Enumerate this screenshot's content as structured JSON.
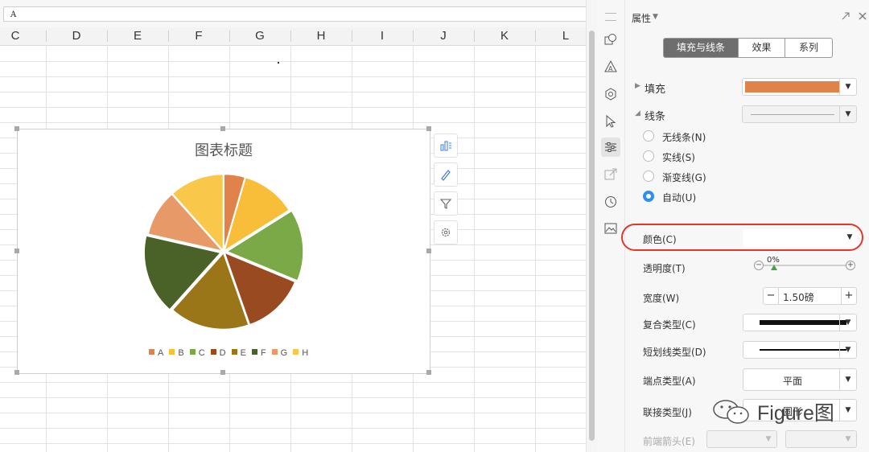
{
  "formula_bar": {
    "value": "A"
  },
  "sheet": {
    "columns": [
      "C",
      "D",
      "E",
      "F",
      "G",
      "H",
      "I",
      "J",
      "K",
      "L"
    ]
  },
  "chart": {
    "tools": [
      {
        "name": "chart-elements-icon"
      },
      {
        "name": "chart-style-icon"
      },
      {
        "name": "chart-filter-icon"
      },
      {
        "name": "chart-settings-icon"
      }
    ]
  },
  "chart_data": {
    "type": "pie",
    "title": "图表标题",
    "categories": [
      "A",
      "B",
      "C",
      "D",
      "E",
      "F",
      "G",
      "H"
    ],
    "values": [
      5,
      13,
      17,
      15,
      19,
      19,
      11,
      13
    ],
    "explode": [
      0,
      0,
      1,
      0,
      0,
      1,
      0,
      0
    ],
    "colors": [
      "#E0834A",
      "#F8BE3A",
      "#7BA947",
      "#9A4A20",
      "#9A7618",
      "#4A6127",
      "#E79A68",
      "#F9C84B"
    ],
    "legend": "bottom"
  },
  "panel": {
    "title": "属性",
    "tabs": [
      {
        "label": "填充与线条",
        "active": true
      },
      {
        "label": "效果",
        "active": false
      },
      {
        "label": "系列",
        "active": false
      }
    ],
    "fill": {
      "label": "填充",
      "color": "#E0834A"
    },
    "line": {
      "label": "线条",
      "options": [
        {
          "label": "无线条(N)",
          "checked": false
        },
        {
          "label": "实线(S)",
          "checked": false
        },
        {
          "label": "渐变线(G)",
          "checked": false
        },
        {
          "label": "自动(U)",
          "checked": true
        }
      ]
    },
    "color_label": "颜色(C)",
    "transparency": {
      "label": "透明度(T)",
      "value": "0%",
      "level": 0
    },
    "width": {
      "label": "宽度(W)",
      "value": "1.50磅",
      "minus": "−",
      "plus": "+"
    },
    "compound_type_label": "复合类型(C)",
    "dash_type_label": "短划线类型(D)",
    "cap_type": {
      "label": "端点类型(A)",
      "value": "平面"
    },
    "join_type": {
      "label": "联接类型(J)",
      "value": "圆形"
    },
    "front_arrow_label": "前端箭头(E)"
  },
  "watermark": {
    "text": "Figure图"
  }
}
